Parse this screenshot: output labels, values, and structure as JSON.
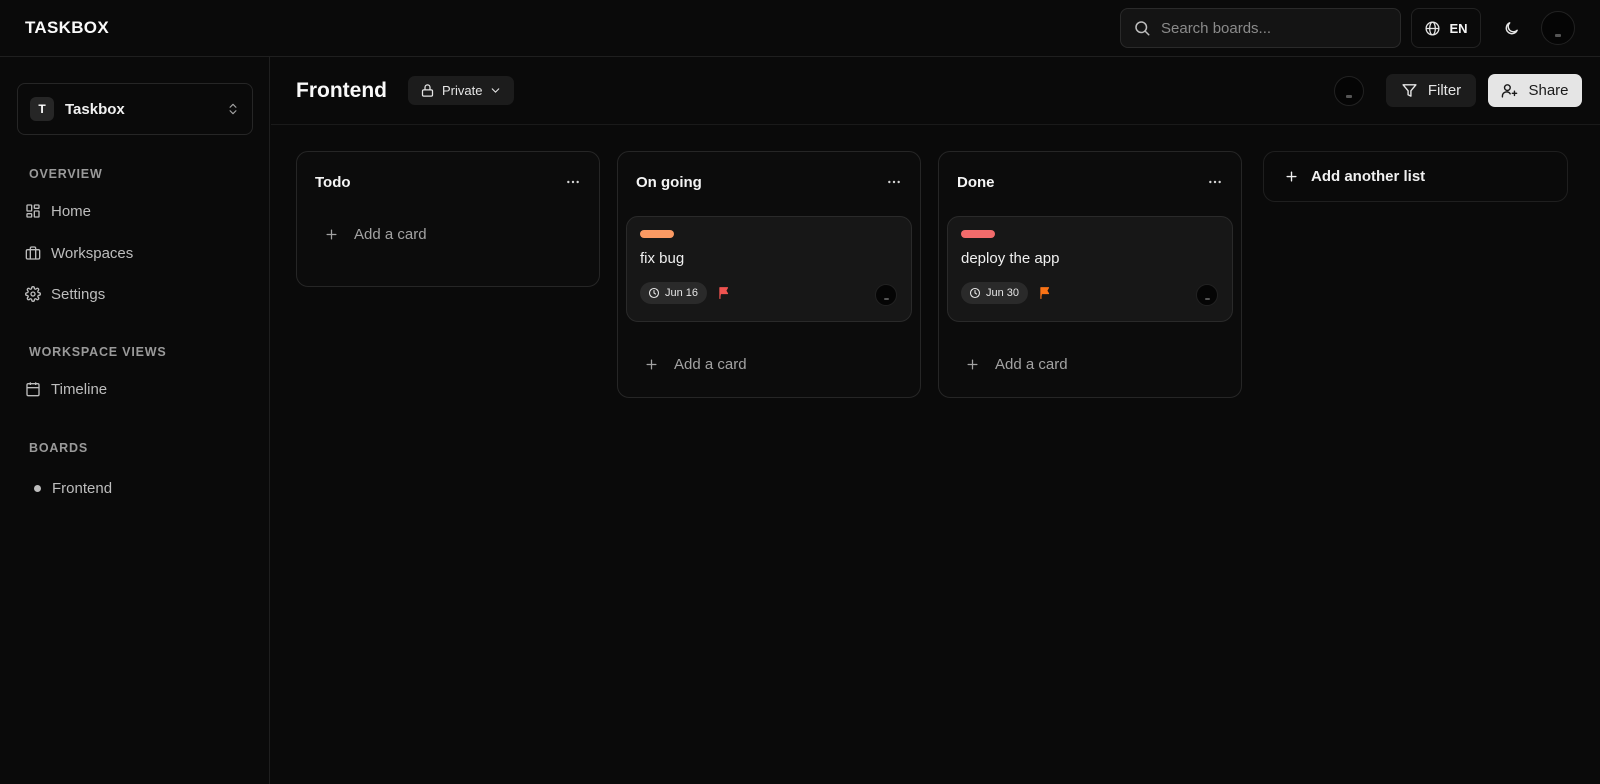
{
  "app": {
    "logo": "TASKBOX"
  },
  "topbar": {
    "search_placeholder": "Search boards...",
    "language": "EN"
  },
  "sidebar": {
    "workspace": {
      "badge": "T",
      "name": "Taskbox"
    },
    "overview_title": "OVERVIEW",
    "overview_items": [
      {
        "label": "Home",
        "icon": "dashboard-icon"
      },
      {
        "label": "Workspaces",
        "icon": "briefcase-icon"
      },
      {
        "label": "Settings",
        "icon": "gear-icon"
      }
    ],
    "views_title": "WORKSPACE VIEWS",
    "views_items": [
      {
        "label": "Timeline",
        "icon": "calendar-icon"
      }
    ],
    "boards_title": "BOARDS",
    "boards": [
      {
        "label": "Frontend"
      }
    ]
  },
  "board": {
    "title": "Frontend",
    "visibility": "Private",
    "filter_label": "Filter",
    "share_label": "Share",
    "add_list_label": "Add another list",
    "lists": [
      {
        "title": "Todo",
        "add_label": "Add a card",
        "cards": []
      },
      {
        "title": "On going",
        "add_label": "Add a card",
        "cards": [
          {
            "title": "fix bug",
            "label_color": "#fb9a63",
            "due": "Jun 16",
            "flag_color": "#ef5350"
          }
        ]
      },
      {
        "title": "Done",
        "add_label": "Add a card",
        "cards": [
          {
            "title": "deploy the app",
            "label_color": "#f26b6b",
            "due": "Jun 30",
            "flag_color": "#f97316"
          }
        ]
      }
    ]
  }
}
